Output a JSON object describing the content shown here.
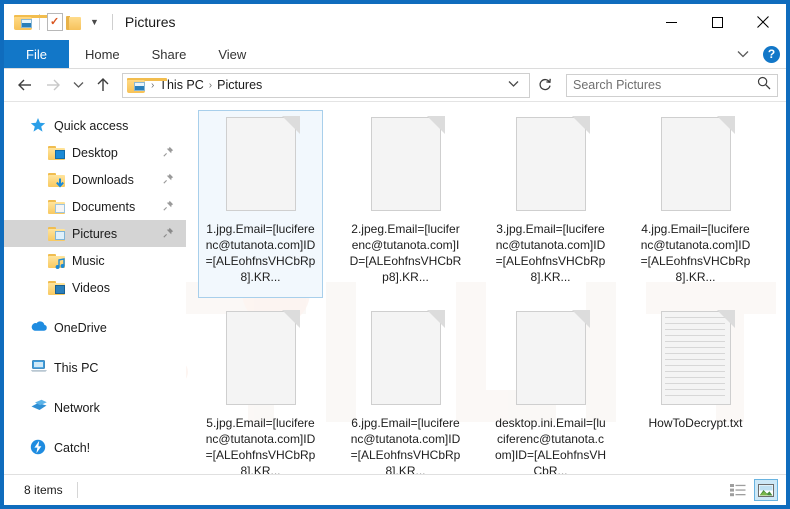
{
  "window": {
    "title": "Pictures",
    "quick_access_toolbar": [
      {
        "name": "pictures-folder-icon",
        "label": "Pictures"
      },
      {
        "name": "properties-icon",
        "label": "Properties"
      },
      {
        "name": "new-folder-icon",
        "label": "New folder"
      },
      {
        "name": "customize-caret-icon",
        "label": "▾"
      }
    ],
    "controls": {
      "minimize": "–",
      "maximize": "□",
      "close": "✕"
    }
  },
  "ribbon": {
    "tabs": [
      {
        "label": "File",
        "active": true
      },
      {
        "label": "Home",
        "active": false
      },
      {
        "label": "Share",
        "active": false
      },
      {
        "label": "View",
        "active": false
      }
    ],
    "expand_caret": "⌄",
    "help_label": "?"
  },
  "address": {
    "back_icon": "←",
    "forward_icon": "→",
    "recent_icon": "⌄",
    "up_icon": "↑",
    "crumbs": [
      "This PC",
      "Pictures"
    ],
    "crumb_separator": "›",
    "dropdown_caret": "⌄",
    "refresh_icon": "↻",
    "search_placeholder": "Search Pictures",
    "search_value": "",
    "search_icon": "search-icon"
  },
  "sidebar": {
    "items": [
      {
        "label": "Quick access",
        "icon": "star-icon",
        "level": 0,
        "pinned": false,
        "selected": false
      },
      {
        "label": "Desktop",
        "icon": "folder-desktop-icon",
        "level": 1,
        "pinned": true,
        "selected": false
      },
      {
        "label": "Downloads",
        "icon": "folder-downloads-icon",
        "level": 1,
        "pinned": true,
        "selected": false
      },
      {
        "label": "Documents",
        "icon": "folder-documents-icon",
        "level": 1,
        "pinned": true,
        "selected": false
      },
      {
        "label": "Pictures",
        "icon": "folder-pictures-icon",
        "level": 1,
        "pinned": true,
        "selected": true
      },
      {
        "label": "Music",
        "icon": "folder-music-icon",
        "level": 1,
        "pinned": false,
        "selected": false
      },
      {
        "label": "Videos",
        "icon": "folder-videos-icon",
        "level": 1,
        "pinned": false,
        "selected": false
      },
      {
        "label": "OneDrive",
        "icon": "onedrive-icon",
        "level": 0,
        "pinned": false,
        "selected": false
      },
      {
        "label": "This PC",
        "icon": "this-pc-icon",
        "level": 0,
        "pinned": false,
        "selected": false
      },
      {
        "label": "Network",
        "icon": "network-icon",
        "level": 0,
        "pinned": false,
        "selected": false
      },
      {
        "label": "Catch!",
        "icon": "catch-icon",
        "level": 0,
        "pinned": false,
        "selected": false
      }
    ]
  },
  "files": [
    {
      "name": "1.jpg.Email=[luciferenc@tutanota.com]ID=[ALEohfnsVHCbRp8].KR...",
      "icon": "blank-file-icon",
      "selected": true
    },
    {
      "name": "2.jpeg.Email=[luciferenc@tutanota.com]ID=[ALEohfnsVHCbRp8].KR...",
      "icon": "blank-file-icon",
      "selected": false
    },
    {
      "name": "3.jpg.Email=[luciferenc@tutanota.com]ID=[ALEohfnsVHCbRp8].KR...",
      "icon": "blank-file-icon",
      "selected": false
    },
    {
      "name": "4.jpg.Email=[luciferenc@tutanota.com]ID=[ALEohfnsVHCbRp8].KR...",
      "icon": "blank-file-icon",
      "selected": false
    },
    {
      "name": "5.jpg.Email=[luciferenc@tutanota.com]ID=[ALEohfnsVHCbRp8].KR...",
      "icon": "blank-file-icon",
      "selected": false
    },
    {
      "name": "6.jpg.Email=[luciferenc@tutanota.com]ID=[ALEohfnsVHCbRp8].KR...",
      "icon": "blank-file-icon",
      "selected": false
    },
    {
      "name": "desktop.ini.Email=[luciferenc@tutanota.com]ID=[ALEohfnsVHCbR...",
      "icon": "blank-file-icon",
      "selected": false
    },
    {
      "name": "HowToDecrypt.txt",
      "icon": "text-file-icon",
      "selected": false
    }
  ],
  "status": {
    "item_count": "8 items",
    "view_details_icon": "details-view-icon",
    "view_large_icons_icon": "large-icons-view-icon"
  },
  "colors": {
    "window_border": "#0f6cbd",
    "file_tab": "#1277c8",
    "selection_fill": "#f2f8fd",
    "selection_border": "#a8cfeb",
    "sidebar_selected": "#d4d4d4"
  }
}
